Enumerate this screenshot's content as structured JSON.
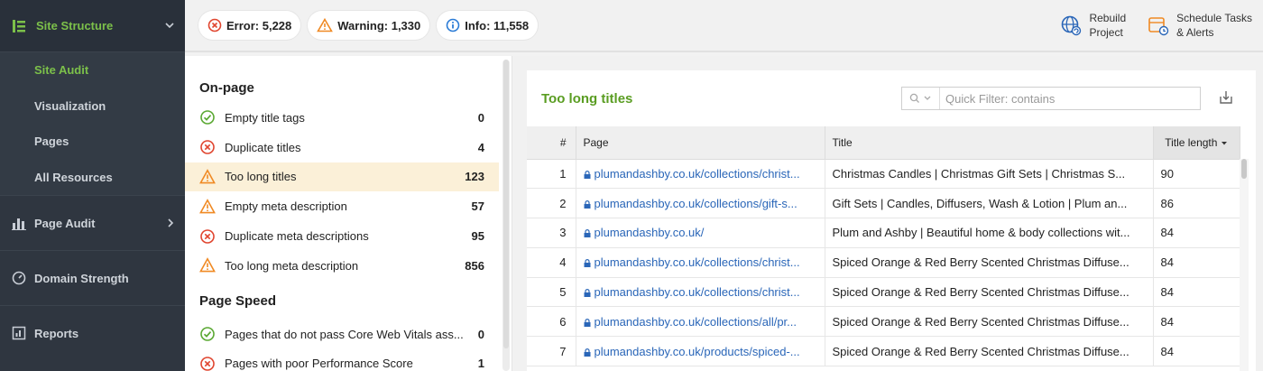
{
  "sidebar": {
    "site_structure": {
      "label": "Site Structure",
      "expanded": true
    },
    "sub_items": [
      {
        "label": "Site Audit",
        "active": true
      },
      {
        "label": "Visualization",
        "active": false
      },
      {
        "label": "Pages",
        "active": false
      },
      {
        "label": "All Resources",
        "active": false
      }
    ],
    "sections": [
      {
        "label": "Page Audit",
        "icon": "bar-chart-icon",
        "has_chevron": true
      },
      {
        "label": "Domain Strength",
        "icon": "gauge-icon",
        "has_chevron": false
      },
      {
        "label": "Reports",
        "icon": "report-icon",
        "has_chevron": false
      }
    ]
  },
  "topbar": {
    "error_label": "Error: 5,228",
    "warning_label": "Warning: 1,330",
    "info_label": "Info: 11,558",
    "rebuild_line1": "Rebuild",
    "rebuild_line2": "Project",
    "schedule_line1": "Schedule Tasks",
    "schedule_line2": "& Alerts"
  },
  "issues": {
    "groups": [
      {
        "title": "On-page",
        "items": [
          {
            "label": "Empty title tags",
            "count": "0",
            "status": "ok"
          },
          {
            "label": "Duplicate titles",
            "count": "4",
            "status": "error"
          },
          {
            "label": "Too long titles",
            "count": "123",
            "status": "warning",
            "selected": true
          },
          {
            "label": "Empty meta description",
            "count": "57",
            "status": "warning"
          },
          {
            "label": "Duplicate meta descriptions",
            "count": "95",
            "status": "error"
          },
          {
            "label": "Too long meta description",
            "count": "856",
            "status": "warning"
          }
        ]
      },
      {
        "title": "Page Speed",
        "items": [
          {
            "label": "Pages that do not pass Core Web Vitals ass...",
            "count": "0",
            "status": "ok"
          },
          {
            "label": "Pages with poor Performance Score",
            "count": "1",
            "status": "error"
          }
        ]
      }
    ]
  },
  "detail": {
    "title": "Too long titles",
    "quick_filter_placeholder": "Quick Filter: contains",
    "columns": {
      "num": "#",
      "page": "Page",
      "title": "Title",
      "length": "Title length"
    },
    "rows": [
      {
        "num": "1",
        "page": "plumandashby.co.uk/collections/christ...",
        "title": "Christmas Candles | Christmas Gift Sets | Christmas S...",
        "length": "90"
      },
      {
        "num": "2",
        "page": "plumandashby.co.uk/collections/gift-s...",
        "title": "Gift Sets | Candles, Diffusers, Wash & Lotion | Plum an...",
        "length": "86"
      },
      {
        "num": "3",
        "page": "plumandashby.co.uk/",
        "title": "Plum and Ashby | Beautiful home & body collections wit...",
        "length": "84"
      },
      {
        "num": "4",
        "page": "plumandashby.co.uk/collections/christ...",
        "title": "Spiced Orange & Red Berry Scented Christmas Diffuse...",
        "length": "84"
      },
      {
        "num": "5",
        "page": "plumandashby.co.uk/collections/christ...",
        "title": "Spiced Orange & Red Berry Scented Christmas Diffuse...",
        "length": "84"
      },
      {
        "num": "6",
        "page": "plumandashby.co.uk/collections/all/pr...",
        "title": "Spiced Orange & Red Berry Scented Christmas Diffuse...",
        "length": "84"
      },
      {
        "num": "7",
        "page": "plumandashby.co.uk/products/spiced-...",
        "title": "Spiced Orange & Red Berry Scented Christmas Diffuse...",
        "length": "84"
      }
    ]
  },
  "colors": {
    "accent_green": "#7cc04a",
    "error": "#e0452f",
    "warning": "#f08a24",
    "info": "#2a7bd6",
    "link": "#2a66b8"
  }
}
